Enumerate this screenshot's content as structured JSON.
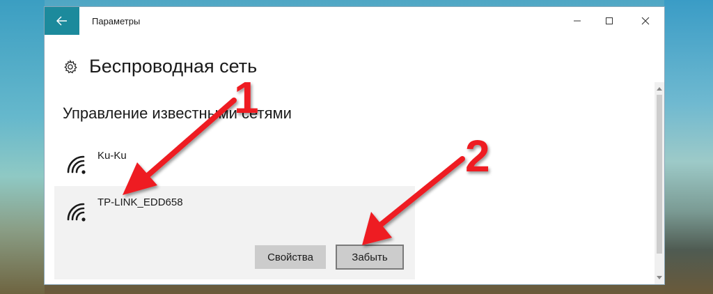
{
  "window": {
    "app_title": "Параметры",
    "accent_color": "#1c8a9c"
  },
  "header": {
    "title": "Беспроводная сеть",
    "icon": "gear-icon"
  },
  "section": {
    "title": "Управление известными сетями"
  },
  "networks": [
    {
      "name": "Ku-Ku",
      "icon": "wifi-icon",
      "selected": false
    },
    {
      "name": "TP-LINK_EDD658",
      "icon": "wifi-icon",
      "selected": true
    }
  ],
  "actions": {
    "properties_label": "Свойства",
    "forget_label": "Забыть"
  },
  "annotations": {
    "marker_1": "1",
    "marker_2": "2",
    "arrow_color": "#ee1c24"
  }
}
